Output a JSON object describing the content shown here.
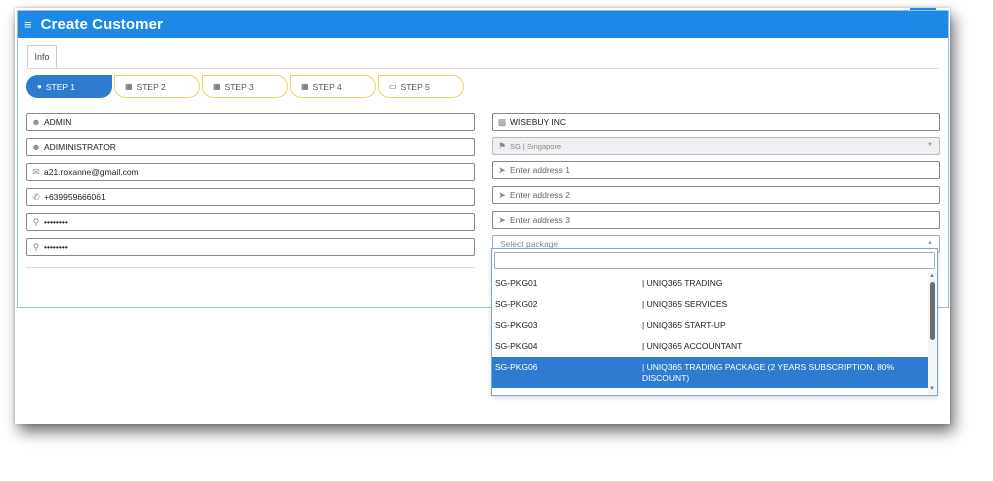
{
  "header": {
    "menu_icon": "hamburger-icon",
    "title": "Create Customer"
  },
  "tabs": [
    {
      "label": "Info"
    }
  ],
  "steps": [
    {
      "label": "STEP 1",
      "icon": "user-icon"
    },
    {
      "label": "STEP 2",
      "icon": "grid-icon"
    },
    {
      "label": "STEP 3",
      "icon": "grid-icon"
    },
    {
      "label": "STEP 4",
      "icon": "grid-icon"
    },
    {
      "label": "STEP 5",
      "icon": "card-icon"
    }
  ],
  "left_fields": {
    "first_name": "ADMIN",
    "last_name": "ADIMINISTRATOR",
    "email": "a21.roxanne@gmail.com",
    "phone": "+639959666061",
    "password": "••••••••",
    "confirm_password": "••••••••"
  },
  "right_fields": {
    "company": "WISEBUY INC",
    "country": "SG | Singapore",
    "address1_placeholder": "Enter address 1",
    "address2_placeholder": "Enter address 2",
    "address3_placeholder": "Enter address 3",
    "package_placeholder": "Select package"
  },
  "package_options": [
    {
      "code": "SG-PKG01",
      "name": "| UNIQ365 TRADING"
    },
    {
      "code": "SG-PKG02",
      "name": "| UNIQ365 SERVICES"
    },
    {
      "code": "SG-PKG03",
      "name": "| UNIQ365 START-UP"
    },
    {
      "code": "SG-PKG04",
      "name": "| UNIQ365 ACCOUNTANT"
    },
    {
      "code": "SG-PKG06",
      "name": "| UNIQ365 TRADING PACKAGE (2 YEARS SUBSCRIPTION, 80% DISCOUNT)"
    }
  ],
  "package_selected": "SG-PKG06",
  "colors": {
    "header": "#1e88e5",
    "step_active": "#2f7bd0",
    "step_border": "#e8d36a",
    "selected_option": "#2f7bd0"
  }
}
